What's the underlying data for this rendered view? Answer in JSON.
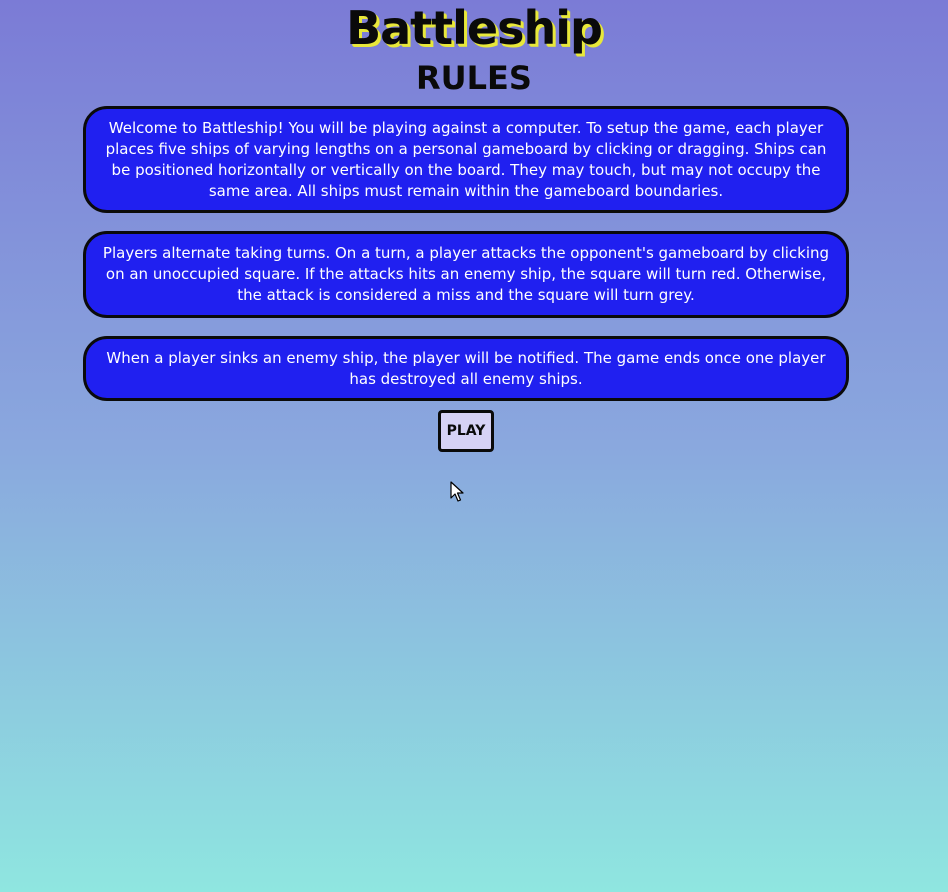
{
  "header": {
    "title": "Battleship",
    "subtitle": "RULES"
  },
  "rules": [
    "Welcome to Battleship! You will be playing against a computer. To setup the game, each player places five ships of varying lengths on a personal gameboard by clicking or dragging. Ships can be positioned horizontally or vertically on the board. They may touch, but may not occupy the same area. All ships must remain within the gameboard boundaries.",
    "Players alternate taking turns. On a turn, a player attacks the opponent's gameboard by clicking on an unoccupied square. If the attacks hits an enemy ship, the square will turn red. Otherwise, the attack is considered a miss and the square will turn grey.",
    "When a player sinks an enemy ship, the player will be notified. The game ends once one player has destroyed all enemy ships."
  ],
  "play_button": {
    "label": "PLAY"
  },
  "colors": {
    "rule_box_fill": "#2020f0",
    "title_shadow": "#e8e83a",
    "play_button_fill": "#d6d2f5",
    "background_top": "#7b7bd6",
    "background_bottom": "#8fe6e0"
  },
  "icons": {
    "cursor": "mouse-pointer-icon"
  }
}
